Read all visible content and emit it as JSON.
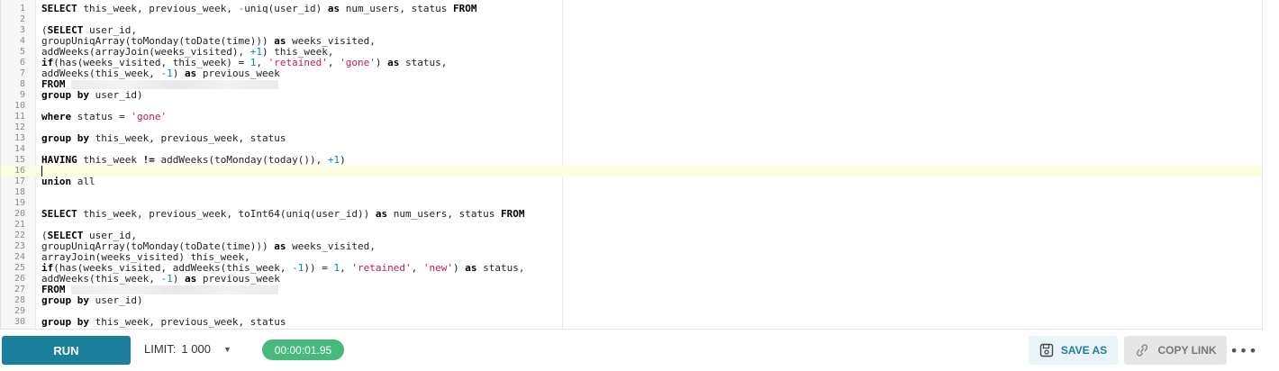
{
  "editor": {
    "active_line": 16,
    "lines": [
      [
        [
          "kw",
          "SELECT"
        ],
        [
          "t",
          " this_week, previous_week, "
        ],
        [
          "n",
          "-"
        ],
        [
          "t",
          "uniq(user_id) "
        ],
        [
          "kw",
          "as"
        ],
        [
          "t",
          " num_users, status "
        ],
        [
          "kw",
          "FROM"
        ]
      ],
      [],
      [
        [
          "t",
          "("
        ],
        [
          "kw",
          "SELECT"
        ],
        [
          "t",
          " user_id,"
        ]
      ],
      [
        [
          "t",
          "groupUniqArray(toMonday(toDate(time))) "
        ],
        [
          "kw",
          "as"
        ],
        [
          "t",
          " weeks_visited,"
        ]
      ],
      [
        [
          "t",
          "addWeeks(arrayJoin(weeks_visited), "
        ],
        [
          "n",
          "+1"
        ],
        [
          "t",
          ") this_week,"
        ]
      ],
      [
        [
          "kw",
          "if"
        ],
        [
          "t",
          "(has(weeks_visited, this_week) = "
        ],
        [
          "n",
          "1"
        ],
        [
          "t",
          ", "
        ],
        [
          "s",
          "'retained'"
        ],
        [
          "t",
          ", "
        ],
        [
          "s",
          "'gone'"
        ],
        [
          "t",
          ") "
        ],
        [
          "kw",
          "as"
        ],
        [
          "t",
          " status,"
        ]
      ],
      [
        [
          "t",
          "addWeeks(this_week, "
        ],
        [
          "n",
          "-1"
        ],
        [
          "t",
          ") "
        ],
        [
          "kw",
          "as"
        ],
        [
          "t",
          " previous_week"
        ]
      ],
      [
        [
          "kw",
          "FROM"
        ],
        [
          "t",
          " "
        ],
        [
          "r",
          ""
        ]
      ],
      [
        [
          "kw",
          "group by"
        ],
        [
          "t",
          " user_id)"
        ]
      ],
      [],
      [
        [
          "kw",
          "where"
        ],
        [
          "t",
          " status = "
        ],
        [
          "s",
          "'gone'"
        ]
      ],
      [],
      [
        [
          "kw",
          "group by"
        ],
        [
          "t",
          " this_week, previous_week, status"
        ]
      ],
      [],
      [
        [
          "kw",
          "HAVING"
        ],
        [
          "t",
          " this_week "
        ],
        [
          "kw",
          "!="
        ],
        [
          "t",
          " addWeeks(toMonday(today()), "
        ],
        [
          "n",
          "+1"
        ],
        [
          "t",
          ")"
        ]
      ],
      [],
      [
        [
          "kw",
          "union"
        ],
        [
          "t",
          " all"
        ]
      ],
      [],
      [],
      [
        [
          "kw",
          "SELECT"
        ],
        [
          "t",
          " this_week, previous_week, toInt64(uniq(user_id)) "
        ],
        [
          "kw",
          "as"
        ],
        [
          "t",
          " num_users, status "
        ],
        [
          "kw",
          "FROM"
        ]
      ],
      [],
      [
        [
          "t",
          "("
        ],
        [
          "kw",
          "SELECT"
        ],
        [
          "t",
          " user_id,"
        ]
      ],
      [
        [
          "t",
          "groupUniqArray(toMonday(toDate(time))) "
        ],
        [
          "kw",
          "as"
        ],
        [
          "t",
          " weeks_visited,"
        ]
      ],
      [
        [
          "t",
          "arrayJoin(weeks_visited) this_week,"
        ]
      ],
      [
        [
          "kw",
          "if"
        ],
        [
          "t",
          "(has(weeks_visited, addWeeks(this_week, "
        ],
        [
          "n",
          "-1"
        ],
        [
          "t",
          ")) = "
        ],
        [
          "n",
          "1"
        ],
        [
          "t",
          ", "
        ],
        [
          "s",
          "'retained'"
        ],
        [
          "t",
          ", "
        ],
        [
          "s",
          "'new'"
        ],
        [
          "t",
          ") "
        ],
        [
          "kw",
          "as"
        ],
        [
          "t",
          " status,"
        ]
      ],
      [
        [
          "t",
          "addWeeks(this_week, "
        ],
        [
          "n",
          "-1"
        ],
        [
          "t",
          ") "
        ],
        [
          "kw",
          "as"
        ],
        [
          "t",
          " previous_week"
        ]
      ],
      [
        [
          "kw",
          "FROM"
        ],
        [
          "t",
          " "
        ],
        [
          "r",
          ""
        ]
      ],
      [
        [
          "kw",
          "group by"
        ],
        [
          "t",
          " user_id)"
        ]
      ],
      [],
      [
        [
          "kw",
          "group by"
        ],
        [
          "t",
          " this_week, previous_week, status"
        ]
      ]
    ]
  },
  "toolbar": {
    "run_label": "RUN",
    "limit_label": "LIMIT:",
    "limit_value": "1 000",
    "timer": "00:00:01.95",
    "save_as_label": "SAVE AS",
    "copy_link_label": "COPY LINK",
    "more_label": "•••"
  },
  "colors": {
    "run": "#1b7f9b",
    "timer": "#47b97d",
    "keyword": "#000000",
    "string": "#c41a4a",
    "number": "#1680b5",
    "active_line": "#fdfde0"
  },
  "icons": {
    "limit_caret": "caret-down-icon",
    "save": "save-icon",
    "copy": "link-icon",
    "more": "more-horizontal-icon"
  }
}
